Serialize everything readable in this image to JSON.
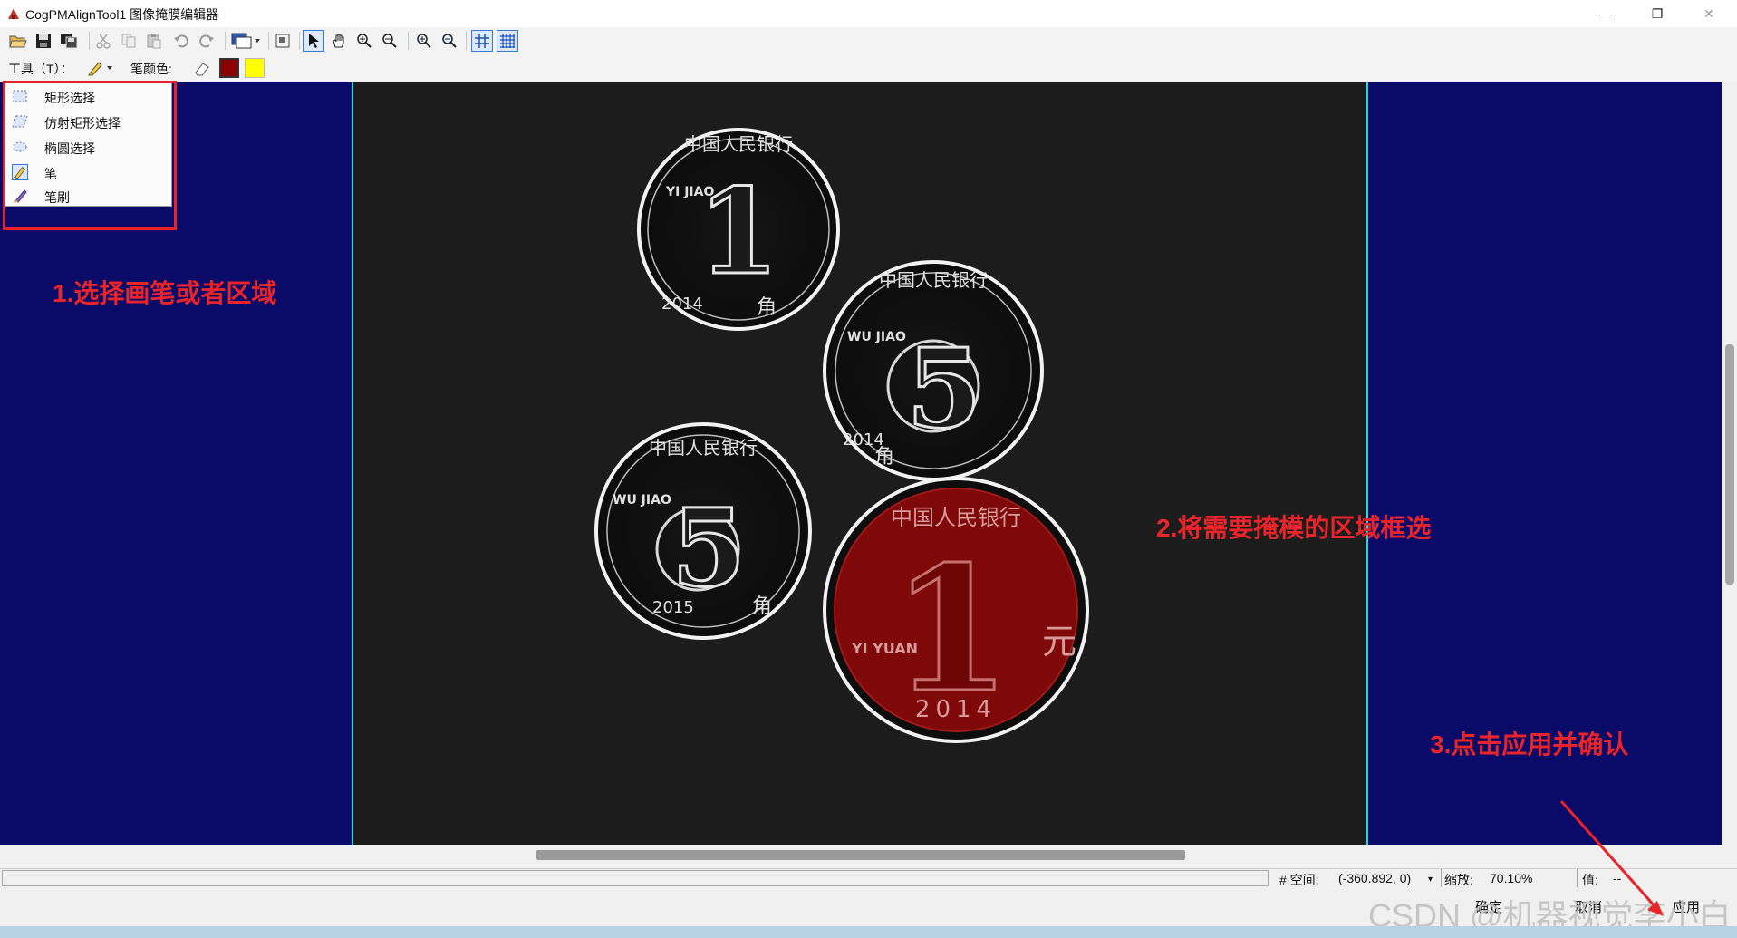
{
  "window": {
    "title": "CogPMAlignTool1 图像掩膜编辑器",
    "minimize_glyph": "—",
    "restore_glyph": "❐",
    "close_glyph": "✕"
  },
  "toolbar": {
    "icons": [
      "open-icon",
      "save-icon",
      "save-as-icon",
      "cut-icon",
      "copy-icon",
      "paste-icon",
      "undo-icon",
      "redo-icon",
      "image-source-icon",
      "fit-icon",
      "pointer-icon",
      "pan-hand-icon",
      "zoom-in-icon",
      "zoom-out-icon",
      "zoom-in-alt-icon",
      "zoom-out-alt-icon",
      "grid-icon",
      "grid-fine-icon"
    ]
  },
  "tools_bar": {
    "tool_label": "工具（T）：",
    "pen_color_label": "笔颜色:",
    "colors": {
      "primary": "#8b0000",
      "secondary": "#ffff00"
    }
  },
  "tool_menu": {
    "items": [
      {
        "label": "矩形选择",
        "icon": "rectangle-select-icon",
        "selected": false
      },
      {
        "label": "仿射矩形选择",
        "icon": "affine-rectangle-select-icon",
        "selected": false
      },
      {
        "label": "椭圆选择",
        "icon": "ellipse-select-icon",
        "selected": false
      },
      {
        "label": "笔",
        "icon": "pen-icon",
        "selected": true
      },
      {
        "label": "笔刷",
        "icon": "brush-icon",
        "selected": false
      }
    ]
  },
  "annotations": {
    "step1": "1.选择画笔或者区域",
    "step2": "2.将需要掩模的区域框选",
    "step3": "3.点击应用并确认"
  },
  "coins": [
    {
      "top": "中国人民银行",
      "value": "1",
      "unit": "角",
      "pinyin": "YI JIAO",
      "year": "2014"
    },
    {
      "top": "中国人民银行",
      "value": "5",
      "unit": "角",
      "pinyin": "WU JIAO",
      "year": "2014"
    },
    {
      "top": "中国人民银行",
      "value": "5",
      "unit": "角",
      "pinyin": "WU JIAO",
      "year": "2015"
    },
    {
      "top": "中国人民银行",
      "value": "1",
      "unit": "元",
      "pinyin": "YI YUAN",
      "year": "2014",
      "masked": true
    }
  ],
  "status": {
    "space_label": "# 空间:",
    "coords": "(-360.892, 0)",
    "zoom_label": "缩放:",
    "zoom": "70.10%",
    "value_label": "值:",
    "value": "--"
  },
  "buttons": {
    "ok": "确定",
    "cancel": "取消",
    "apply": "应用"
  },
  "watermark": "CSDN @机器视觉李小白",
  "colors": {
    "canvas_bg": "#0a0a68",
    "image_border": "#2ad4de",
    "annotation_red": "#e8242b",
    "mask_red": "#8b0000"
  }
}
